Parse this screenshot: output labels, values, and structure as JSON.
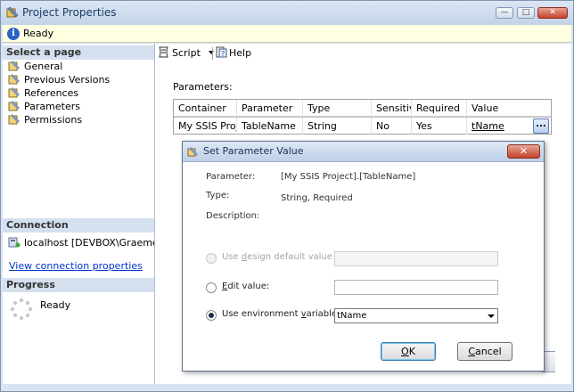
{
  "window": {
    "title": "Project Properties",
    "controls": [
      "—",
      "□",
      "✕"
    ]
  },
  "status": {
    "text": "Ready"
  },
  "left": {
    "select_page_header": "Select a page",
    "pages": [
      {
        "label": "General"
      },
      {
        "label": "Previous Versions"
      },
      {
        "label": "References"
      },
      {
        "label": "Parameters"
      },
      {
        "label": "Permissions"
      }
    ],
    "connection_header": "Connection",
    "connection_server": "localhost [DEVBOX\\Graeme]",
    "connection_link": "View connection properties",
    "progress_header": "Progress",
    "progress_status": "Ready"
  },
  "toolbar": {
    "script_label": "Script",
    "help_label": "Help"
  },
  "parameters": {
    "label": "Parameters:",
    "columns": [
      "Container",
      "Parameter",
      "Type",
      "Sensitive",
      "Required",
      "Value"
    ],
    "rows": [
      {
        "container": "My SSIS Proj...",
        "parameter": "TableName",
        "type": "String",
        "sensitive": "No",
        "required": "Yes",
        "value": "tName"
      }
    ],
    "ellipsis": "..."
  },
  "dialog": {
    "title": "Set Parameter Value",
    "close": "✕",
    "parameter_label": "Parameter:",
    "parameter_value": "[My SSIS Project].[TableName]",
    "type_label": "Type:",
    "type_value": "String, Required",
    "description_label": "Description:",
    "option_default_pre": "Use ",
    "option_default_key": "d",
    "option_default_post": "esign default value",
    "option_edit_pre": "",
    "option_edit_key": "E",
    "option_edit_post": "dit value:",
    "option_env_pre": "Use environment ",
    "option_env_key": "v",
    "option_env_post": "ariable:",
    "env_variable_value": "tName",
    "ok_key": "O",
    "ok_post": "K",
    "cancel_key": "C",
    "cancel_post": "ancel"
  }
}
